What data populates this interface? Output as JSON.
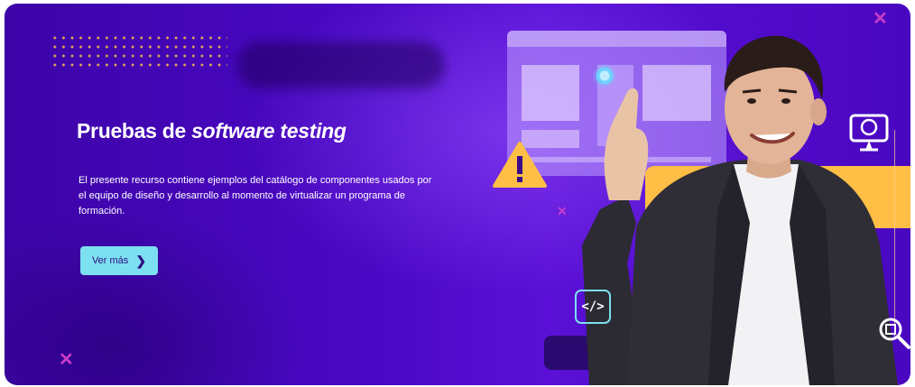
{
  "hero": {
    "title_prefix": "Pruebas de ",
    "title_emphasis": "software testing",
    "description": "El presente recurso contiene ejemplos del catálogo de componentes usados por el equipo de diseño y desarrollo al momento de virtualizar un programa de formación.",
    "button_label": "Ver más",
    "code_badge": "</>"
  },
  "colors": {
    "background": "#4a08c4",
    "button": "#7ce0f0",
    "accent_yellow": "#ffbe45",
    "dots": "#f2b84a"
  },
  "icons": [
    "chevron-right-icon",
    "warning-icon",
    "code-icon",
    "monitor-icon",
    "search-icon",
    "close-icon"
  ]
}
